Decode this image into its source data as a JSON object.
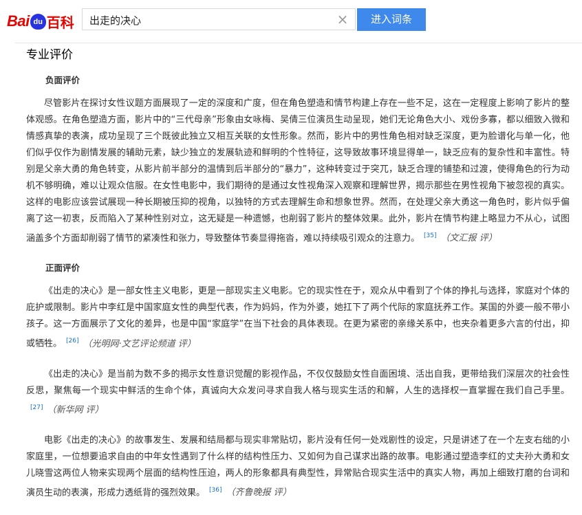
{
  "header": {
    "logo": {
      "part1": "Bai",
      "paw": "du",
      "part2": "百科"
    },
    "search": {
      "value": "出走的决心",
      "clear_icon": "×"
    },
    "search_button": "进入词条"
  },
  "section": {
    "title": "专业评价",
    "negative": {
      "title": "负面评价",
      "para": "尽管影片在探讨女性议题方面展现了一定的深度和广度，但在角色塑造和情节构建上存在一些不足，这在一定程度上影响了影片的整体观感。在角色塑造方面，影片中的“三代母亲”形象由女咏梅、吴倩三位演员生动呈现，她们无论角色大小、戏份多寡，都以细致入微和情感真挚的表演，成功呈现了三个既彼此独立又相互关联的女性形象。然而，影片中的男性角色相对缺乏深度，更为脸谱化与单一化，他们似乎仅作为剧情发展的辅助元素，缺少独立的发展轨迹和鲜明的个性特征，这导致故事环境显得单一，缺乏应有的复杂性和丰富性。特别是父亲大勇的角色转变，从影片前半部分的温情到后半部分的“暴力”，这种转变过于突兀，缺乏合理的铺垫和过渡，使得角色的行为动机不够明确，难以让观众信服。在女性电影中，我们期待的是通过女性视角深入观察和理解世界，揭示那些在男性视角下被忽视的真实。这样的电影应该尝试展现一种长期被压抑的视角，以独特的方式去理解生命和想象世界。然而，在处理父亲大勇这一角色时，影片似乎偏离了这一初衷，反而陷入了某种性别对立，这无疑是一种遗憾，也削弱了影片的整体效果。此外，影片在情节构建上略显力不从心，试图涵盖多个方面却削弱了情节的紧凑性和张力，导致整体节奏显得拖沓，难以持续吸引观众的注意力。",
      "ref": "[35]",
      "source": "（文汇报 评）"
    },
    "positive": {
      "title": "正面评价",
      "paras": [
        {
          "text": "《出走的决心》是一部女性主义电影，更是一部现实主义电影。它的现实性在于，观众从中看到了个体的挣扎与选择，家庭对个体的庇护或限制。影片中李红是中国家庭女性的典型代表，作为妈妈，作为外婆，她扛下了两个代际的家庭抚养工作。某国的外婆一般不带小孩子。这一方面展示了文化的差异，也是中国“家庭学”在当下社会的具体表现。在更为紧密的亲缘关系中，也夹杂着更多六言的付出，抑或牺牲。",
          "ref": "[26]",
          "source": "（光明网·文艺评论频道 评）"
        },
        {
          "text": "《出走的决心》是当前为数不多的揭示女性意识觉醒的影视作品，不仅仅鼓励女性自面困境、活出自我，更带给我们深层次的社会性反思，聚焦每一个现实中鲜活的生命个体，真诚向大众发问寻求自我人格与现实生活的和解，人生的选择权一直掌握在我们自己手里。",
          "ref": "[27]",
          "source": "（新华网 评）"
        },
        {
          "text": "电影《出走的决心》的故事发生、发展和结局都与现实非常贴切，影片没有任何一处戏剧性的设定，只是讲述了在一个左支右绌的小家庭里，一位想要追求自由的中年女性遇到了什么样的结构性压力、又如何为自己谋求出路的故事。电影通过塑造李红的丈夫孙大勇和女儿晓雪这两位人物来实现两个层面的结构性压迫，两人的形象都具有典型性，异常贴合现实生活中的真实人物，再加上细致打磨的台词和演员生动的表演，形成力透纸背的强烈效果。",
          "ref": "[36]",
          "source": "（齐鲁晚报 评）"
        }
      ]
    }
  }
}
